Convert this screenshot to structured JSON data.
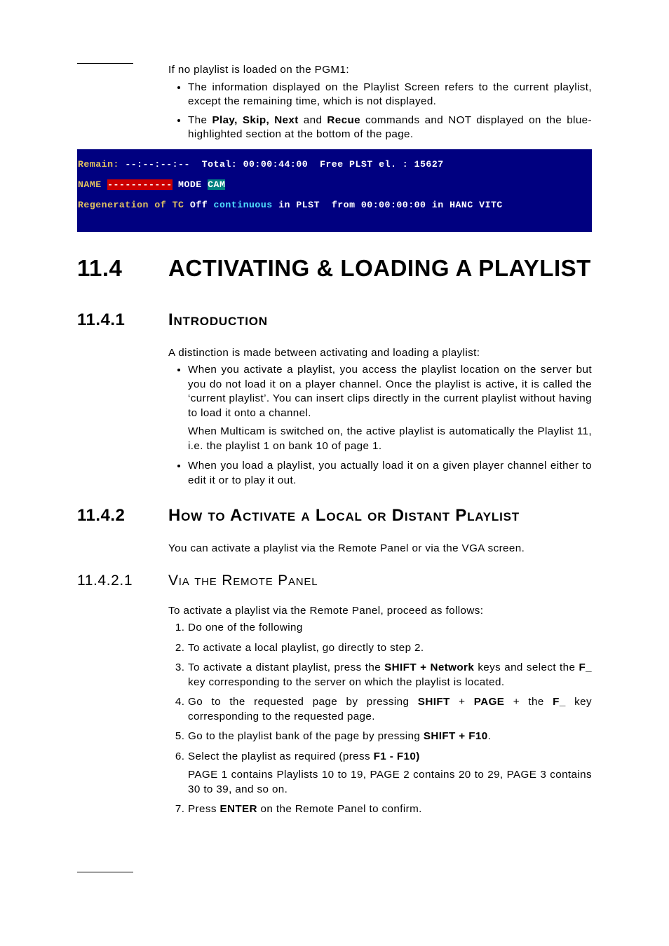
{
  "intro_line": "If no playlist is loaded on the PGM1:",
  "intro_bullets": [
    {
      "pre": "The information displayed on the Playlist Screen refers to the current playlist, except the remaining time, which is not displayed."
    },
    {
      "pre": "The ",
      "b1": "Play, Skip, Next",
      "mid": " and ",
      "b2": "Recue",
      "post": " commands and NOT displayed on the blue-highlighted section at the bottom of the page."
    }
  ],
  "strip": {
    "line1_a": "Remain: ",
    "line1_b": "--:--:--:--",
    "line1_c": "  Total: 00:00:44:00  Free PLST el. : 15627",
    "line2_a": "NAME ",
    "line2_b": "-----------",
    "line2_c": " MODE ",
    "line2_d": "CAM",
    "line3_a": "Regeneration of TC ",
    "line3_b": "Off",
    "line3_c": " continuous",
    "line3_d": " in PLST  from 00:00:00:00 in HANC VITC"
  },
  "h_11_4_num": "11.4",
  "h_11_4_title": "ACTIVATING & LOADING A PLAYLIST",
  "h_11_4_1_num": "11.4.1",
  "h_11_4_1_title": "Introduction",
  "p_intro": "A distinction is made between activating and loading a playlist:",
  "act_bullets": [
    "When you activate a playlist, you access the playlist location on the server but you do not load it on a player channel. Once the playlist is active, it is called the ‘current playlist’. You can insert clips directly in the current playlist without having to load it onto a channel.",
    "When you load a playlist, you actually load it on a given player channel either to edit it or to play it out."
  ],
  "act_bullet1_extra": "When Multicam is switched on, the active playlist is automatically the Playlist 11, i.e. the playlist 1 on bank 10 of page 1.",
  "h_11_4_2_num": "11.4.2",
  "h_11_4_2_title": "How to Activate a Local or Distant Playlist",
  "p_11_4_2": "You can activate a playlist via the Remote Panel or via the VGA screen.",
  "h_11_4_2_1_num": "11.4.2.1",
  "h_11_4_2_1_title": "Via the Remote Panel",
  "p_11_4_2_1": "To activate a playlist via the Remote Panel, proceed as follows:",
  "steps": {
    "s1": "Do one of the following",
    "s2": "To activate a local playlist, go directly to step 2.",
    "s3_a": "To activate a distant playlist, press the ",
    "s3_b": "SHIFT + Network",
    "s3_c": " keys and select the ",
    "s3_d": "F_",
    "s3_e": " key corresponding to the server on which the playlist is located.",
    "s4_a": "Go to the requested page by pressing ",
    "s4_b": "SHIFT",
    "s4_c": " + ",
    "s4_d": "PAGE",
    "s4_e": " + the ",
    "s4_f": "F_",
    "s4_g": " key corresponding to the requested page.",
    "s5_a": "Go to the playlist bank of the page by pressing ",
    "s5_b": "SHIFT  +  F10",
    "s5_c": ".",
    "s6_a": "Select the playlist as required (press ",
    "s6_b": "F1 - F10)",
    "s6_extra": "PAGE 1 contains Playlists 10 to 19, PAGE 2 contains 20 to 29, PAGE 3 contains 30 to 39, and so on.",
    "s7_a": "Press ",
    "s7_b": "ENTER",
    "s7_c": " on the Remote Panel to confirm."
  }
}
